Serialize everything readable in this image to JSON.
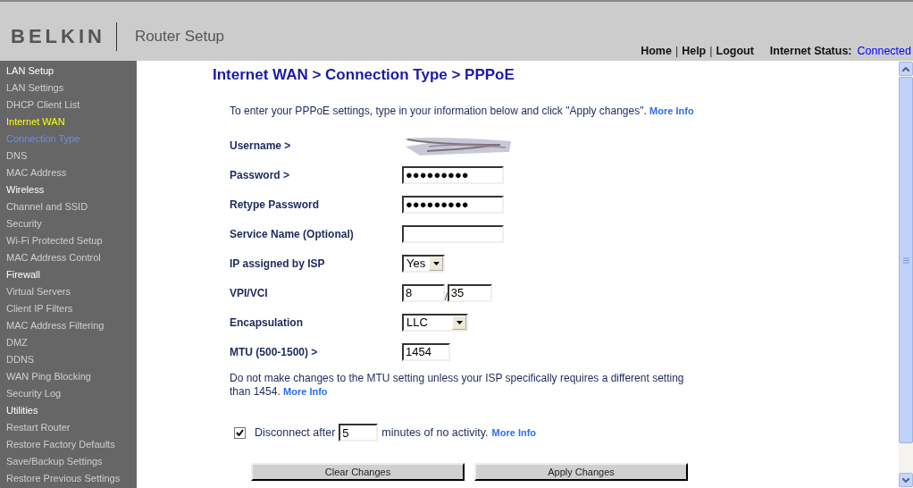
{
  "header": {
    "logo": "BELKIN",
    "title": "Router Setup",
    "nav": [
      {
        "kind": "link",
        "text": "Home"
      },
      {
        "kind": "sep",
        "text": "|"
      },
      {
        "kind": "link",
        "text": "Help"
      },
      {
        "kind": "sep",
        "text": "|"
      },
      {
        "kind": "link",
        "text": "Logout"
      }
    ],
    "status_label": "Internet Status:",
    "status_value": "Connected"
  },
  "sidebar": {
    "sections": [
      {
        "label": "LAN Setup",
        "selected": false,
        "items": [
          {
            "label": "LAN Settings",
            "selected": false
          },
          {
            "label": "DHCP Client List",
            "selected": false
          }
        ]
      },
      {
        "label": "Internet WAN",
        "selected": true,
        "items": [
          {
            "label": "Connection Type",
            "selected": true
          },
          {
            "label": "DNS",
            "selected": false
          },
          {
            "label": "MAC Address",
            "selected": false
          }
        ]
      },
      {
        "label": "Wireless",
        "selected": false,
        "items": [
          {
            "label": "Channel and SSID",
            "selected": false
          },
          {
            "label": "Security",
            "selected": false
          },
          {
            "label": "Wi-Fi Protected Setup",
            "selected": false
          },
          {
            "label": "MAC Address Control",
            "selected": false
          }
        ]
      },
      {
        "label": "Firewall",
        "selected": false,
        "items": [
          {
            "label": "Virtual Servers",
            "selected": false
          },
          {
            "label": "Client IP Filters",
            "selected": false
          },
          {
            "label": "MAC Address Filtering",
            "selected": false
          },
          {
            "label": "DMZ",
            "selected": false
          },
          {
            "label": "DDNS",
            "selected": false
          },
          {
            "label": "WAN Ping Blocking",
            "selected": false
          },
          {
            "label": "Security Log",
            "selected": false
          }
        ]
      },
      {
        "label": "Utilities",
        "selected": false,
        "items": [
          {
            "label": "Restart Router",
            "selected": false
          },
          {
            "label": "Restore Factory Defaults",
            "selected": false
          },
          {
            "label": "Save/Backup Settings",
            "selected": false
          },
          {
            "label": "Restore Previous Settings",
            "selected": false
          }
        ]
      }
    ]
  },
  "page": {
    "title": "Internet WAN > Connection Type > PPPoE",
    "intro": {
      "text": "To enter your PPPoE settings, type in your information below and click \"Apply changes\".",
      "link": "More Info"
    },
    "fields": [
      {
        "label": "Username >",
        "kind": "redacted"
      },
      {
        "label": "Password >",
        "kind": "text",
        "value": "●●●●●●●●●"
      },
      {
        "label": "Retype Password",
        "kind": "text",
        "value": "●●●●●●●●●"
      },
      {
        "label": "Service Name (Optional)",
        "kind": "text"
      },
      {
        "label": "IP assigned by ISP",
        "kind": "select",
        "value": "Yes"
      },
      {
        "label": "VPI/VCI",
        "kind": "pair",
        "values": [
          "8",
          "35"
        ],
        "separator": "/"
      },
      {
        "label": "Encapsulation",
        "kind": "select",
        "value": "LLC"
      },
      {
        "label": "MTU (500-1500) >",
        "kind": "short",
        "value": "1454"
      }
    ],
    "note": {
      "text": "Do not make changes to the MTU setting unless your ISP specifically requires a different setting than 1454.",
      "link": "More Info"
    },
    "disconnect": {
      "checked": true,
      "before": "Disconnect after",
      "value": "5",
      "after": "minutes of no activity.",
      "link": "More Info"
    },
    "buttons": [
      "Clear Changes",
      "Apply Changes"
    ]
  }
}
